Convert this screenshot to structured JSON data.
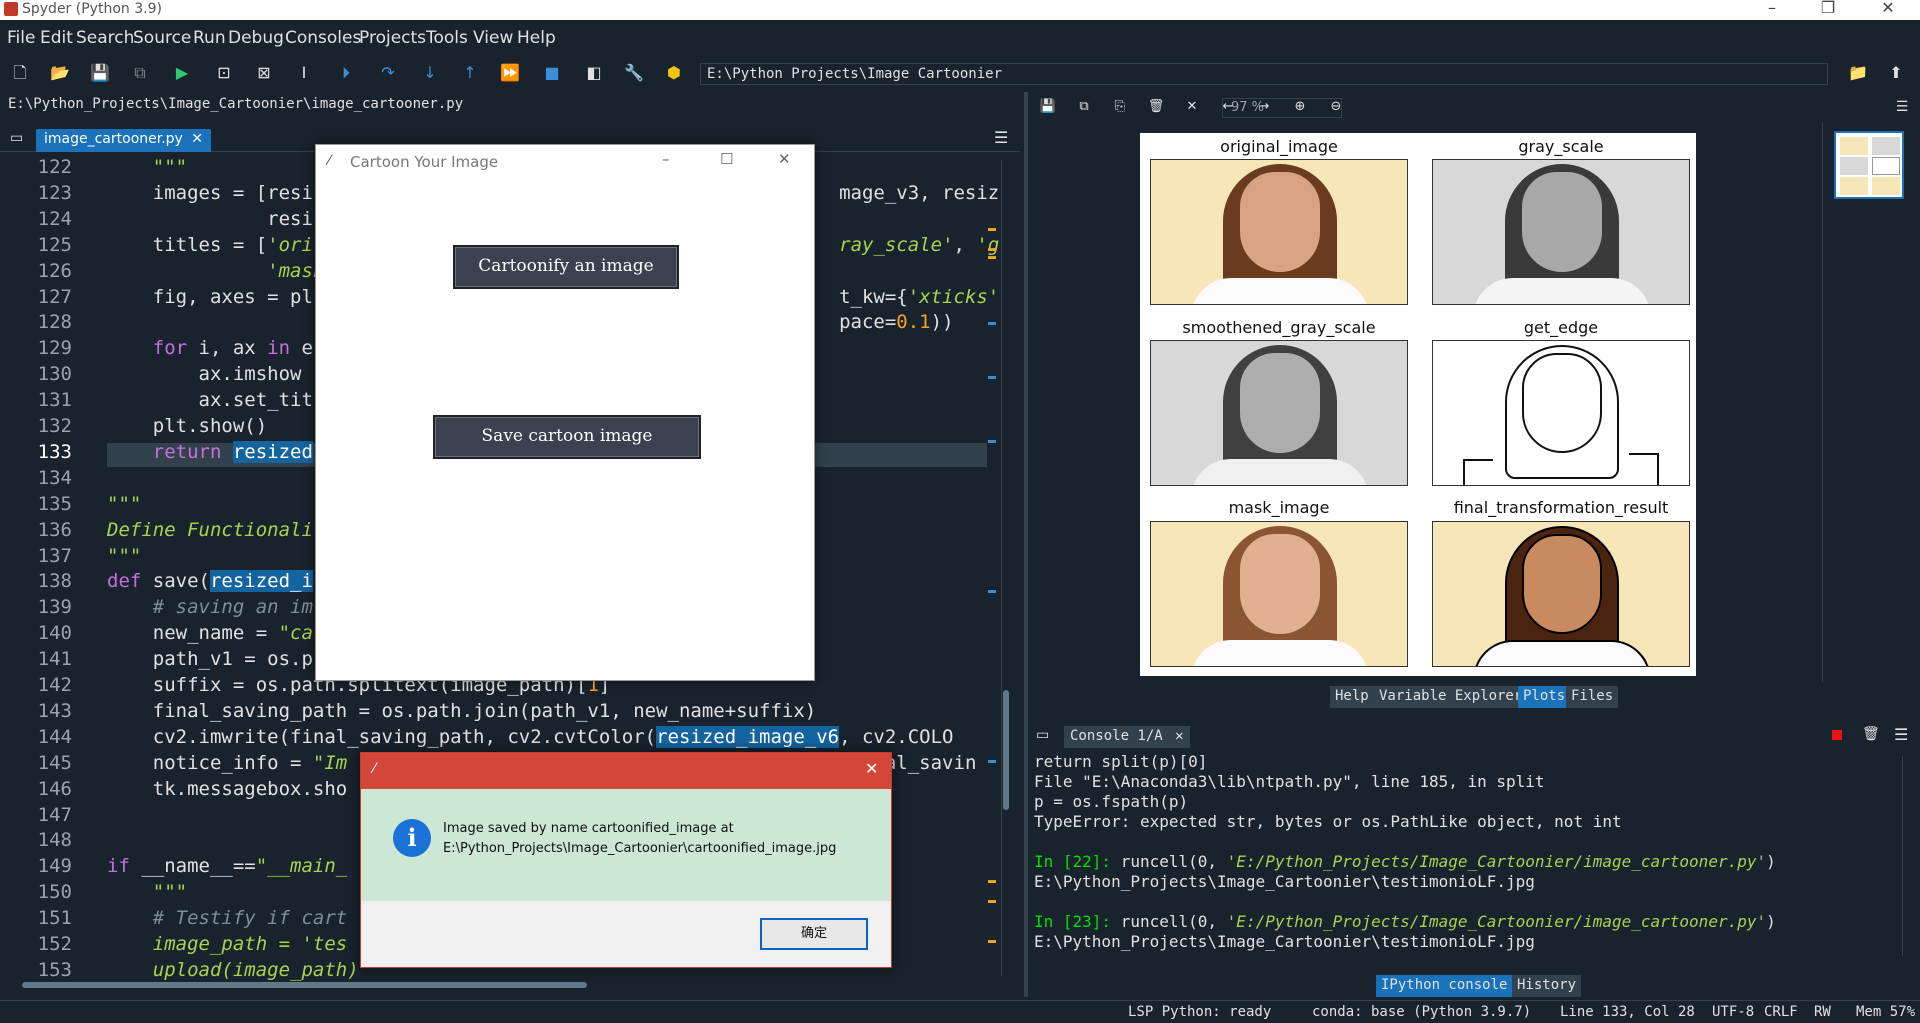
{
  "window": {
    "title": "Spyder (Python 3.9)"
  },
  "menu": [
    "File",
    "Edit",
    "Search",
    "Source",
    "Run",
    "Debug",
    "Consoles",
    "Projects",
    "Tools",
    "View",
    "Help"
  ],
  "toolbar": {
    "working_dir": "E:\\Python Projects\\Image Cartoonier"
  },
  "editor": {
    "file_path": "E:\\Python_Projects\\Image_Cartoonier\\image_cartooner.py",
    "tab_label": "image_cartooner.py",
    "current_line": "133",
    "lines": [
      {
        "n": "122",
        "html": "    <span class='str'>\"\"\"</span>"
      },
      {
        "n": "123",
        "html": "    images = [resi                                              mage_v3, resiz"
      },
      {
        "n": "124",
        "html": "              resi"
      },
      {
        "n": "125",
        "html": "    titles = [<span class='str'>'ori</span>                                              <span class='str'>ray_scale'</span>, <span class='str'>'gr</span>"
      },
      {
        "n": "126",
        "html": "              <span class='str'>'mask</span>"
      },
      {
        "n": "127",
        "html": "    fig, axes = pl                                              t_kw={<span class='str'>'xticks'</span>"
      },
      {
        "n": "128",
        "html": "                                                                pace=<span class='num'>0.1</span>))"
      },
      {
        "n": "129",
        "html": "    <span class='kw'>for</span> i, ax <span class='kw'>in</span> e"
      },
      {
        "n": "130",
        "html": "        ax.imshow"
      },
      {
        "n": "131",
        "html": "        ax.set_tit"
      },
      {
        "n": "132",
        "html": "    plt.show()"
      },
      {
        "n": "133",
        "html": "    <span class='kw'>return</span> <span class='hl'>resized</span>"
      },
      {
        "n": "134",
        "html": ""
      },
      {
        "n": "135",
        "html": "<span class='str'>\"\"\"</span>"
      },
      {
        "n": "136",
        "html": "<span class='str'>Define Functionali</span>"
      },
      {
        "n": "137",
        "html": "<span class='str'>\"\"\"</span>"
      },
      {
        "n": "138",
        "html": "<span class='kw'>def</span> save(<span class='hl'>resized_i</span>"
      },
      {
        "n": "139",
        "html": "    <span class='cm'># saving an im</span>"
      },
      {
        "n": "140",
        "html": "    new_name = <span class='str'>\"ca</span>"
      },
      {
        "n": "141",
        "html": "    path_v1 = os.p"
      },
      {
        "n": "142",
        "html": "    suffix = os.path.splitext(image_path)[<span class='num'>1</span>]"
      },
      {
        "n": "143",
        "html": "    final_saving_path = os.path.join(path_v1, new_name+suffix)"
      },
      {
        "n": "144",
        "html": "    cv2.imwrite(final_saving_path, cv2.cvtColor(<span class='hl'>resized_image_v6</span>, cv2.COLO"
      },
      {
        "n": "145",
        "html": "    notice_info = <span class='str'>\"Im</span>                                              nal_savin"
      },
      {
        "n": "146",
        "html": "    tk.messagebox.sho"
      },
      {
        "n": "147",
        "html": ""
      },
      {
        "n": "148",
        "html": ""
      },
      {
        "n": "149",
        "html": "<span class='kw'>if</span> __name__==<span class='str'>\"__main_</span>"
      },
      {
        "n": "150",
        "html": "    <span class='str'>\"\"\"</span>"
      },
      {
        "n": "151",
        "html": "    <span class='cm'># Testify if cart</span>"
      },
      {
        "n": "152",
        "html": "    <span class='str'>image_path = 'tes</span>"
      },
      {
        "n": "153",
        "html": "    <span class='str'>upload(image_path)</span>"
      }
    ]
  },
  "plots": {
    "zoom": "97 %",
    "titles": [
      "original_image",
      "gray_scale",
      "smoothened_gray_scale",
      "get_edge",
      "mask_image",
      "final_transformation_result"
    ],
    "tabs": [
      "Help",
      "Variable Explorer",
      "Plots",
      "Files"
    ]
  },
  "console": {
    "tab_label": "Console 1/A",
    "lines": [
      {
        "cls": "",
        "text": "    return split(p)[0]"
      },
      {
        "cls": "",
        "text": "  File \"E:\\Anaconda3\\lib\\ntpath.py\", line 185, in split"
      },
      {
        "cls": "",
        "text": "    p = os.fspath(p)"
      },
      {
        "cls": "",
        "text": "TypeError: expected str, bytes or os.PathLike object, not int"
      },
      {
        "cls": "",
        "text": ""
      },
      {
        "cls": "cin",
        "prompt": "In [22]: ",
        "cmd": "runcell(0, ",
        "arg": "'E:/Python_Projects/Image_Cartoonier/image_cartooner.py'",
        "end": ")"
      },
      {
        "cls": "",
        "text": "E:\\Python_Projects\\Image_Cartoonier\\testimonioLF.jpg"
      },
      {
        "cls": "",
        "text": ""
      },
      {
        "cls": "cin",
        "prompt": "In [23]: ",
        "cmd": "runcell(0, ",
        "arg": "'E:/Python_Projects/Image_Cartoonier/image_cartooner.py'",
        "end": ")"
      },
      {
        "cls": "",
        "text": "E:\\Python_Projects\\Image_Cartoonier\\testimonioLF.jpg"
      }
    ],
    "bottom_tabs": [
      "IPython console",
      "History"
    ]
  },
  "status": {
    "lsp": "LSP Python: ready",
    "conda": "conda: base (Python 3.9.7)",
    "position": "Line 133, Col 28",
    "encoding": "UTF-8",
    "eol": "CRLF",
    "rw": "RW",
    "mem": "Mem 57%"
  },
  "cartoon_window": {
    "title": "Cartoon Your Image",
    "btn_cartoonify": "Cartoonify an image",
    "btn_save": "Save cartoon image"
  },
  "messagebox": {
    "line1": "Image saved by name cartoonified_image at",
    "line2": "E:\\Python_Projects\\Image_Cartoonier\\cartoonified_image.jpg",
    "ok": "确定",
    "icon_glyph": "i"
  }
}
